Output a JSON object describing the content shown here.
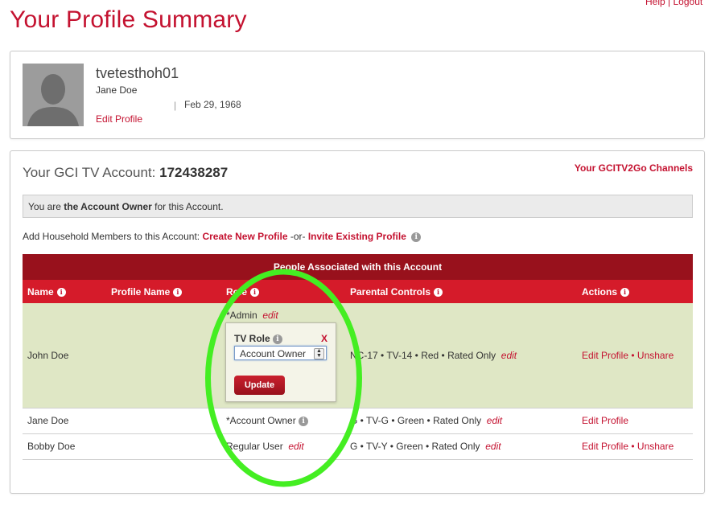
{
  "top_links": {
    "help": "Help",
    "separator": "|",
    "logout": "Logout"
  },
  "page_title": "Your Profile Summary",
  "profile": {
    "username": "tvetesthoh01",
    "full_name": "Jane Doe",
    "separator": "|",
    "dob": "Feb 29, 1968",
    "edit_link": "Edit Profile"
  },
  "account": {
    "title_prefix": "Your GCI TV Account:",
    "number": "172438287",
    "channels_link": "Your GCITV2Go Channels",
    "owner_pre": "You are ",
    "owner_bold": "the Account Owner",
    "owner_post": " for this Account.",
    "household_label": "Add Household Members to this Account: ",
    "create_link": "Create New Profile",
    "or_text": " -or- ",
    "invite_link": "Invite Existing Profile"
  },
  "table": {
    "title": "People Associated with this Account",
    "columns": [
      "Name",
      "Profile Name",
      "Role",
      "Parental Controls",
      "Actions"
    ],
    "rows": [
      {
        "name": "John Doe",
        "role": "*Admin",
        "role_edit": "edit",
        "parental": "NC-17 • TV-14 • Red • Rated Only",
        "parental_edit": "edit",
        "action1": "Edit Profile",
        "action_sep": " • ",
        "action2": "Unshare"
      },
      {
        "name": "Jane Doe",
        "role": "*Account Owner",
        "parental": "G • TV-G • Green • Rated Only",
        "parental_edit": "edit",
        "action1": "Edit Profile"
      },
      {
        "name": "Bobby Doe",
        "role": "Regular User",
        "role_edit": "edit",
        "parental": "G • TV-Y • Green • Rated Only",
        "parental_edit": "edit",
        "action1": "Edit Profile",
        "action_sep": " • ",
        "action2": "Unshare"
      }
    ]
  },
  "popup": {
    "title": "TV Role",
    "close": "X",
    "selected": "Account Owner",
    "button": "Update"
  },
  "colors": {
    "brand_red": "#c41230",
    "header_dark": "#98111c",
    "header_red": "#d51b2a",
    "highlight": "#44ee22"
  }
}
